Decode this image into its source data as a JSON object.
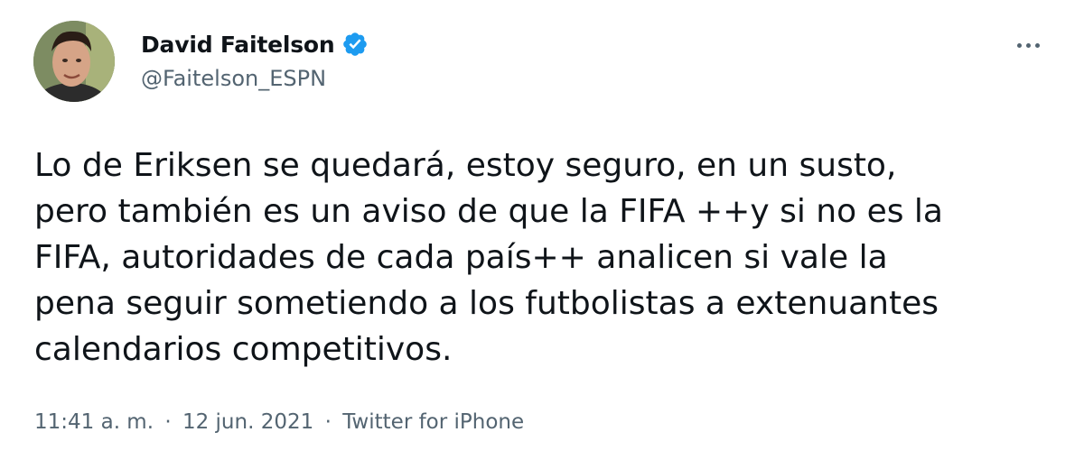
{
  "tweet": {
    "author": {
      "display_name": "David Faitelson",
      "handle": "@Faitelson_ESPN",
      "verified": true,
      "verified_badge_color": "#1d9bf0"
    },
    "more_icon": "more-horizontal-icon",
    "text_lines": [
      "Lo de Eriksen se quedará, estoy seguro, en un susto,",
      "pero también es un aviso de que la FIFA ++y si no es la",
      "FIFA, autoridades de cada país++ analicen si vale la",
      "pena seguir sometiendo a los futbolistas a extenuantes",
      "calendarios competitivos."
    ],
    "meta": {
      "time": "11:41 a. m.",
      "separator": "·",
      "date": "12 jun. 2021",
      "source": "Twitter for iPhone"
    }
  },
  "colors": {
    "text_primary": "#0f1419",
    "text_secondary": "#536471",
    "background": "#ffffff"
  }
}
